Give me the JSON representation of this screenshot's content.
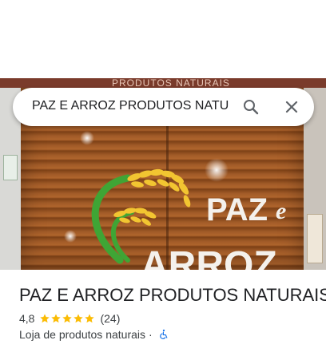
{
  "search": {
    "query": "PAZ E ARROZ PRODUTOS NATURAIS"
  },
  "photo": {
    "sign_text": "PRODUTOS NATURAIS",
    "logo_line1": "PAZ",
    "logo_line1_small": "e",
    "logo_line2": "ARROZ"
  },
  "place": {
    "title": "PAZ E ARROZ PRODUTOS NATURAIS",
    "rating": "4,8",
    "stars": 5,
    "reviews": "(24)",
    "category": "Loja de produtos naturais",
    "separator": "·"
  },
  "icons": {
    "search": "search-icon",
    "close": "close-icon",
    "star": "star-icon",
    "accessibility": "wheelchair-accessible-icon"
  },
  "colors": {
    "star": "#FBBC04",
    "accessibility": "#1A73E8",
    "logo_white": "#F4F1EC",
    "wheat_yellow": "#F2C531",
    "stem_green": "#3FA535"
  }
}
